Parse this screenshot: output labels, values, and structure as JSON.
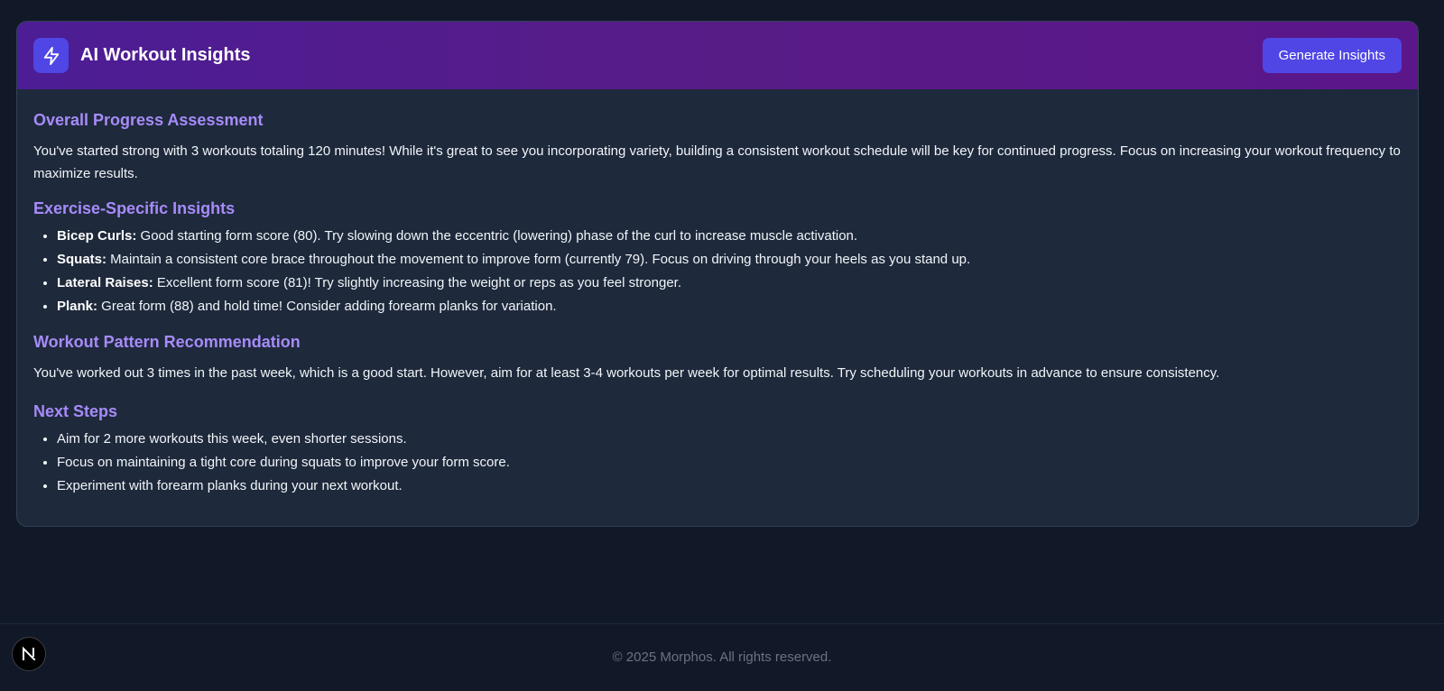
{
  "header": {
    "title": "AI Workout Insights",
    "button_label": "Generate Insights",
    "icon": "lightning-bolt-icon"
  },
  "sections": {
    "overall": {
      "title": "Overall Progress Assessment",
      "text": "You've started strong with 3 workouts totaling 120 minutes! While it's great to see you incorporating variety, building a consistent workout schedule will be key for continued progress. Focus on increasing your workout frequency to maximize results."
    },
    "exercise": {
      "title": "Exercise-Specific Insights",
      "items": [
        {
          "name": "Bicep Curls:",
          "text": " Good starting form score (80). Try slowing down the eccentric (lowering) phase of the curl to increase muscle activation."
        },
        {
          "name": "Squats:",
          "text": " Maintain a consistent core brace throughout the movement to improve form (currently 79). Focus on driving through your heels as you stand up."
        },
        {
          "name": "Lateral Raises:",
          "text": " Excellent form score (81)! Try slightly increasing the weight or reps as you feel stronger."
        },
        {
          "name": "Plank:",
          "text": " Great form (88) and hold time! Consider adding forearm planks for variation."
        }
      ]
    },
    "pattern": {
      "title": "Workout Pattern Recommendation",
      "text": "You've worked out 3 times in the past week, which is a good start. However, aim for at least 3-4 workouts per week for optimal results. Try scheduling your workouts in advance to ensure consistency."
    },
    "next": {
      "title": "Next Steps",
      "items": [
        "Aim for 2 more workouts this week, even shorter sessions.",
        "Focus on maintaining a tight core during squats to improve your form score.",
        "Experiment with forearm planks during your next workout."
      ]
    }
  },
  "footer": {
    "copyright": "© 2025 Morphos. All rights reserved."
  },
  "badge": {
    "letter": "N",
    "icon": "nextjs-logo-icon"
  },
  "colors": {
    "background": "#111827",
    "card": "#1e293b",
    "accent": "#4f46e5",
    "heading": "#a78bfa",
    "header_gradient_start": "#4c1d95",
    "header_gradient_end": "#5b168a"
  }
}
